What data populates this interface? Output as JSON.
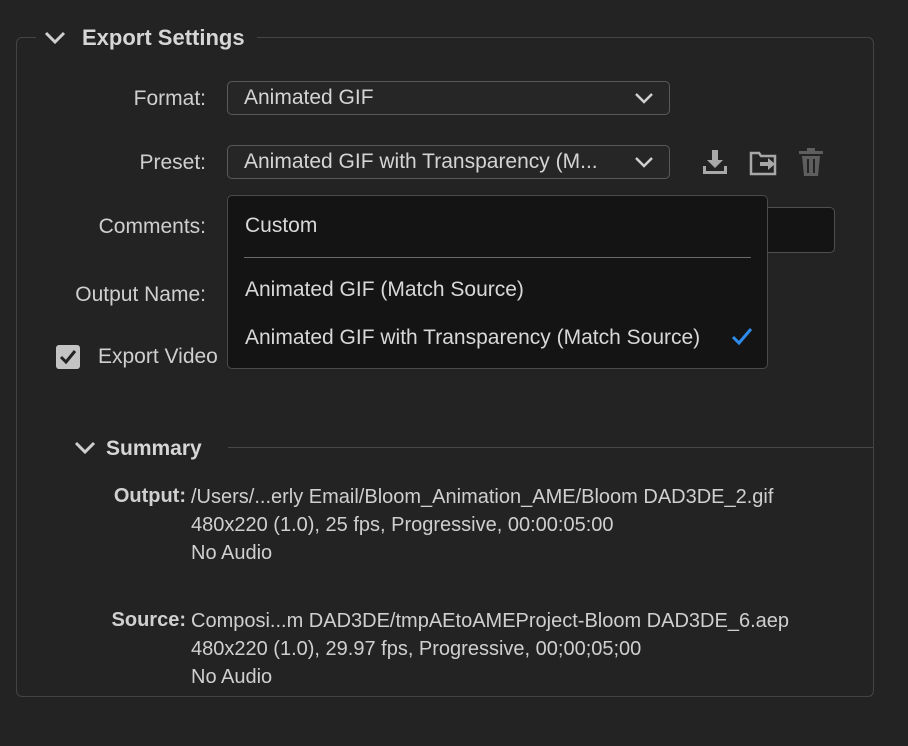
{
  "export_settings": {
    "title": "Export Settings",
    "format": {
      "label": "Format:",
      "value": "Animated GIF"
    },
    "preset": {
      "label": "Preset:",
      "value": "Animated GIF with Transparency (M..."
    },
    "comments_label": "Comments:",
    "output_name_label": "Output Name:",
    "export_video": {
      "label": "Export Video",
      "checked": true
    }
  },
  "preset_dropdown": {
    "items": [
      {
        "label": "Custom",
        "selected": false
      },
      {
        "label": "Animated GIF (Match Source)",
        "selected": false
      },
      {
        "label": "Animated GIF with Transparency (Match Source)",
        "selected": true
      }
    ]
  },
  "summary": {
    "title": "Summary",
    "output": {
      "label": "Output:",
      "lines": [
        "/Users/...erly Email/Bloom_Animation_AME/Bloom DAD3DE_2.gif",
        "480x220 (1.0), 25 fps, Progressive, 00:00:05:00",
        "No Audio"
      ]
    },
    "source": {
      "label": "Source:",
      "lines": [
        "Composi...m DAD3DE/tmpAEtoAMEProject-Bloom DAD3DE_6.aep",
        "480x220 (1.0), 29.97 fps, Progressive, 00;00;05;00",
        "No Audio"
      ]
    }
  },
  "icons": [
    "chevron-down-icon",
    "save-preset-icon",
    "import-preset-icon",
    "delete-preset-icon",
    "checkmark-icon"
  ],
  "colors": {
    "background": "#232323",
    "dropdown_bg": "#141414",
    "accent_check": "#2d8ceb"
  }
}
